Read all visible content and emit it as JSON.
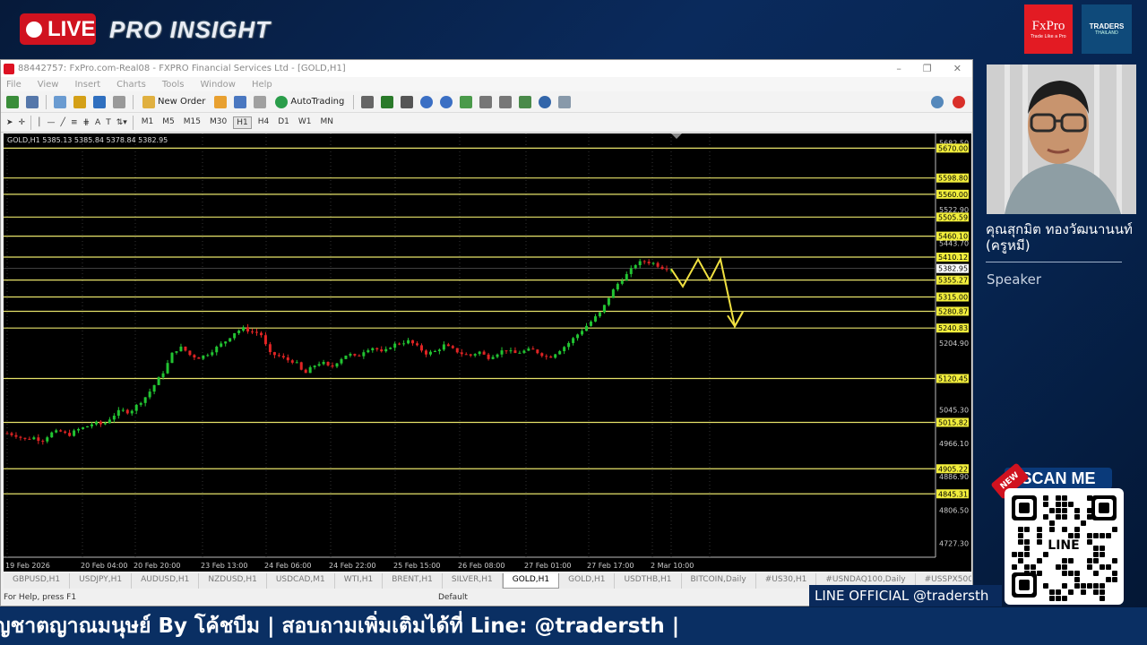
{
  "broadcast": {
    "live_label": "LIVE",
    "show_title": "PRO INSIGHT",
    "logos": {
      "fxpro": "FxPro",
      "fxpro_tagline": "Trade Like a Pro",
      "traders": "TRADERS",
      "traders_sub": "THAILAND"
    }
  },
  "window": {
    "title": "88442757: FxPro.com-Real08 - FXPRO Financial Services Ltd - [GOLD,H1]",
    "menu": [
      "File",
      "View",
      "Insert",
      "Charts",
      "Tools",
      "Window",
      "Help"
    ],
    "toolbar": {
      "new_order": "New Order",
      "auto_trading": "AutoTrading"
    },
    "timeframes": [
      "M1",
      "M5",
      "M15",
      "M30",
      "H1",
      "H4",
      "D1",
      "W1",
      "MN"
    ],
    "active_timeframe": "H1",
    "chart_header": "GOLD,H1  5385.13 5385.84 5378.84 5382.95",
    "symbol_tabs": [
      "GBPUSD,H1",
      "USDJPY,H1",
      "AUDUSD,H1",
      "NZDUSD,H1",
      "USDCAD,M1",
      "WTI,H1",
      "BRENT,H1",
      "SILVER,H1",
      "GOLD,H1",
      "GOLD,H1",
      "USDTHB,H1",
      "BITCOIN,Daily",
      "#US30,H1",
      "#USNDAQ100,Daily",
      "#USSPX500"
    ],
    "active_tab": "GOLD,H1",
    "status_left": "For Help, press F1",
    "status_mid": "Default"
  },
  "chart_data": {
    "type": "candlestick",
    "symbol": "GOLD,H1",
    "ylim": [
      4660,
      5705
    ],
    "x_labels": [
      "19 Feb 2026",
      "20 Feb 04:00",
      "20 Feb 20:00",
      "23 Feb 13:00",
      "24 Feb 06:00",
      "24 Feb 22:00",
      "25 Feb 15:00",
      "26 Feb 08:00",
      "27 Feb 01:00",
      "27 Feb 17:00",
      "2 Mar 10:00"
    ],
    "y_ticks": [
      5682.5,
      5522.9,
      5443.7,
      5204.9,
      5045.3,
      4966.1,
      4886.9,
      4806.5,
      4727.3
    ],
    "current_price": 5382.95,
    "levels": [
      5670.0,
      5598.8,
      5560.0,
      5505.59,
      5460.1,
      5410.12,
      5355.27,
      5315.0,
      5280.87,
      5240.83,
      5120.45,
      5015.82,
      4905.22,
      4845.31
    ],
    "close_path": [
      4990,
      4985,
      4975,
      4980,
      4972,
      4990,
      4995,
      4985,
      4998,
      5005,
      5015,
      5010,
      5030,
      5045,
      5040,
      5060,
      5080,
      5110,
      5140,
      5185,
      5195,
      5175,
      5170,
      5180,
      5195,
      5210,
      5230,
      5240,
      5232,
      5228,
      5180,
      5175,
      5165,
      5160,
      5130,
      5150,
      5160,
      5145,
      5165,
      5180,
      5170,
      5190,
      5195,
      5180,
      5200,
      5205,
      5210,
      5195,
      5180,
      5185,
      5200,
      5190,
      5180,
      5175,
      5185,
      5170,
      5180,
      5190,
      5180,
      5185,
      5190,
      5180,
      5170,
      5185,
      5200,
      5220,
      5240,
      5260,
      5280,
      5320,
      5350,
      5370,
      5395,
      5400,
      5395,
      5385,
      5382.95
    ],
    "forecast_path": [
      [
        5382,
        5382
      ],
      [
        5340,
        5340
      ],
      [
        5405,
        5405
      ],
      [
        5355,
        5355
      ],
      [
        5405,
        5405
      ],
      [
        5245,
        5245
      ],
      [
        5280,
        5280
      ]
    ]
  },
  "speaker": {
    "name": "คุณสุกมิต ทองวัฒนานนท์ (ครูหมี)",
    "role": "Speaker"
  },
  "qr": {
    "tag": "NEW",
    "banner": "SCAN ME",
    "center_label": "LINE",
    "line_official": "LINE OFFICIAL @tradersth"
  },
  "ticker": {
    "text": "ญชาตญาณมนุษย์ By โค้ชบีม | สอบถามเพิ่มเติมได้ที่ Line: @tradersth |"
  }
}
